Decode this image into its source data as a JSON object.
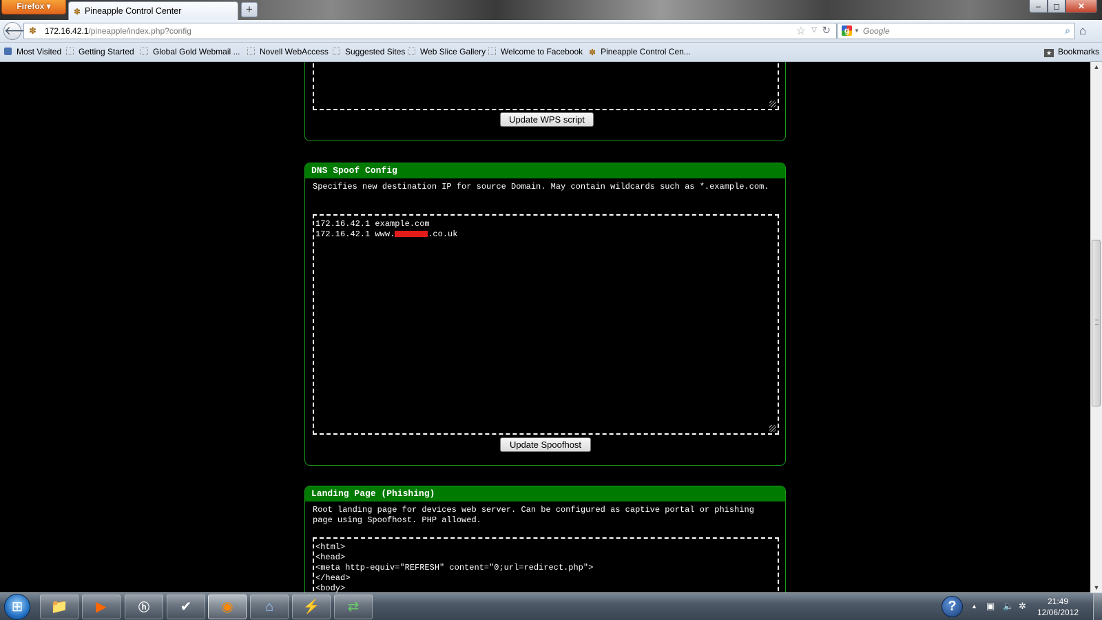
{
  "browser": {
    "menu_button": "Firefox",
    "tab": {
      "favicon": "pineapple-icon",
      "title": "Pineapple Control Center"
    },
    "new_tab_symbol": "+",
    "window_controls": {
      "minimize": "–",
      "maximize": "◻",
      "close": "✕"
    },
    "url": {
      "host": "172.16.42.1",
      "path": "/pineapple/index.php?config"
    },
    "search": {
      "engine": "Google",
      "placeholder": "Google"
    }
  },
  "bookmarks_toolbar": {
    "items": [
      {
        "label": "Most Visited",
        "icon": "most-visited-icon"
      },
      {
        "label": "Getting Started",
        "icon": "page-icon"
      },
      {
        "label": "Global Gold Webmail ...",
        "icon": "page-icon"
      },
      {
        "label": "Novell WebAccess",
        "icon": "page-icon"
      },
      {
        "label": "Suggested Sites",
        "icon": "page-icon"
      },
      {
        "label": "Web Slice Gallery",
        "icon": "page-icon"
      },
      {
        "label": "Welcome to Facebook",
        "icon": "page-icon"
      },
      {
        "label": "Pineapple Control Cen...",
        "icon": "pineapple-icon"
      }
    ],
    "bookmarks_menu": "Bookmarks"
  },
  "page": {
    "wps_panel": {
      "button": "Update WPS script"
    },
    "dns_spoof": {
      "title": "DNS Spoof Config",
      "description": "Specifies new destination IP for source Domain. May contain wildcards such as *.example.com.",
      "lines": {
        "line1": "172.16.42.1 example.com",
        "line2_prefix": "172.16.42.1 www.",
        "line2_suffix": ".co.uk"
      },
      "button": "Update Spoofhost"
    },
    "landing_page": {
      "title": "Landing Page (Phishing)",
      "description": "Root landing page for devices web server. Can be configured as captive portal or phishing page using Spoofhost. PHP allowed.",
      "code": "<html>\n<head>\n<meta http-equiv=\"REFRESH\" content=\"0;url=redirect.php\">\n</head>\n<body>\n<"
    }
  },
  "taskbar": {
    "apps": [
      "windows-explorer-icon",
      "media-player-icon",
      "hp-icon",
      "task-app-icon",
      "firefox-icon",
      "network-app-icon",
      "remote-app-icon",
      "transfer-app-icon"
    ],
    "help_symbol": "?",
    "clock": {
      "time": "21:49",
      "date": "12/06/2012"
    }
  },
  "colors": {
    "panel_header": "#007a00",
    "panel_border": "#1a9a1a",
    "page_background": "#000000",
    "redaction": "#e21b1b"
  }
}
